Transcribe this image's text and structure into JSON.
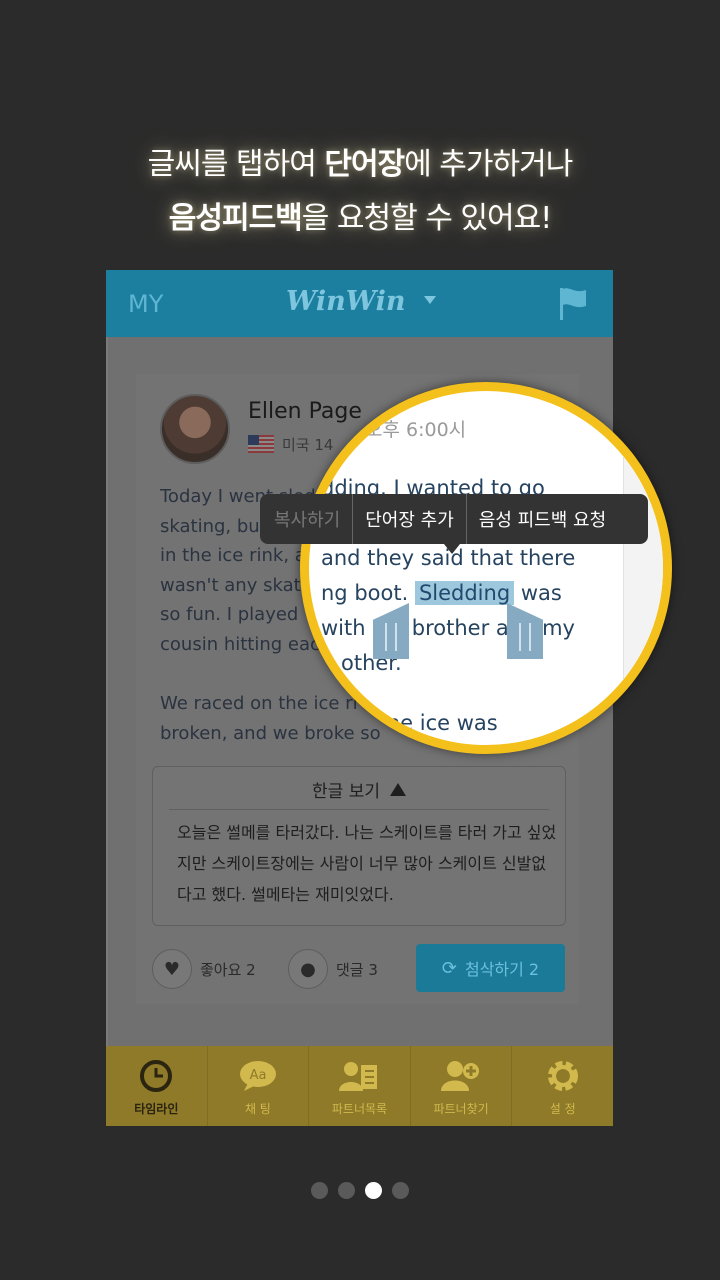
{
  "headline": {
    "line1_pre": "글씨를 탭하여 ",
    "line1_bold": "단어장",
    "line1_post": "에 추가하거나",
    "line2_bold": "음성피드백",
    "line2_post": "을  요청할 수  있어요!"
  },
  "topbar": {
    "my": "MY",
    "logo": "WinWin"
  },
  "post": {
    "user_name": "Ellen Page",
    "meta": "미국 14",
    "paragraph1": "Today I went sled",
    "p1_lines": [
      "Today I went sled",
      "skating, bu",
      "in the ice rink, and they said that there",
      "wasn't any skat",
      "so fun. I played",
      "cousin hitting eac"
    ],
    "p2_lines": [
      "We raced on the ice ri",
      "broken, and we broke so"
    ],
    "korean_toggle": "한글 보기",
    "korean_text": "오늘은 썰메를 타러갔다. 나는 스케이트를 타러 가고 싶었지만 스케이트장에는 사람이 너무 많아 스케이트 신발없다고 했다. 썰메타는 재미잇었다.",
    "like_label": "좋아요 2",
    "comment_label": "댓글 3",
    "share_label": "첨삭하기 2"
  },
  "tabs": [
    {
      "label": "타임라인",
      "icon": "clock-icon"
    },
    {
      "label": "채  팅",
      "icon": "chat-icon"
    },
    {
      "label": "파트너목록",
      "icon": "partner-list-icon"
    },
    {
      "label": "파트너찾기",
      "icon": "add-partner-icon"
    },
    {
      "label": "설  정",
      "icon": "gear-icon"
    }
  ],
  "lens": {
    "time": "오후 6:00시",
    "line1": "dding. I wanted to go",
    "line3": " and they said that there",
    "line4_pre": "ng boot. ",
    "line4_hl": "Sledding",
    "line4_post": " was",
    "line5": " with my brother and my",
    "line6": "h other.",
    "line8": "ld. Some ice was"
  },
  "popup": {
    "copy": "복사하기",
    "add_vocab": "단어장 추가",
    "voice_feedback": "음성 피드백 요청"
  },
  "pager": {
    "count": 4,
    "active": 3
  },
  "colors": {
    "accent_blue": "#1da8d8",
    "tab_yellow": "#f4c01b"
  }
}
